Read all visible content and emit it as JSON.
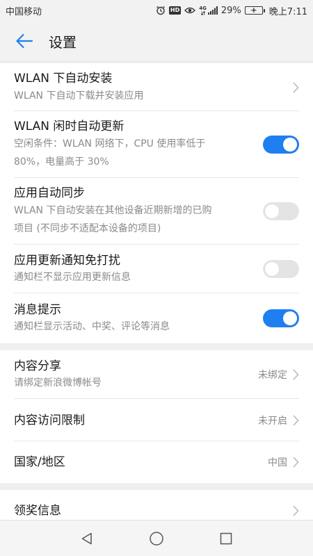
{
  "status_bar": {
    "carrier": "中国移动",
    "hd_label": "HD",
    "network_label": "4G",
    "battery_percent": "29%",
    "time": "晚上7:11",
    "icons": [
      "alarm-clock-icon",
      "hd-icon",
      "eye-icon",
      "network-4g-icon",
      "signal-icon",
      "battery-charging-icon"
    ]
  },
  "header": {
    "title": "设置",
    "back_icon": "arrow-left-icon",
    "accent_color": "#1f7ff0"
  },
  "settings": {
    "wlan_auto_install": {
      "title": "WLAN 下自动安装",
      "desc": "WLAN 下自动下载并安装应用"
    },
    "wlan_idle_update": {
      "title": "WLAN 闲时自动更新",
      "desc_line1": "空闲条件：WLAN 网络下，CPU 使用率低于",
      "desc_line2": "80%，电量高于 30%",
      "enabled": true
    },
    "app_auto_sync": {
      "title": "应用自动同步",
      "desc_line1": "WLAN 下自动安装在其他设备近期新增的已购",
      "desc_line2": "项目 (不同步不适配本设备的项目)",
      "enabled": false
    },
    "update_notify_dnd": {
      "title": "应用更新通知免打扰",
      "desc": "通知栏不显示应用更新信息",
      "enabled": false
    },
    "message_tips": {
      "title": "消息提示",
      "desc": "通知栏显示活动、中奖、评论等消息",
      "enabled": true
    },
    "content_share": {
      "title": "内容分享",
      "desc": "请绑定新浪微博帐号",
      "value": "未绑定"
    },
    "content_access_limit": {
      "title": "内容访问限制",
      "value": "未开启"
    },
    "country_region": {
      "title": "国家/地区",
      "value": "中国"
    },
    "prize_info": {
      "title": "领奖信息"
    }
  },
  "nav_bar": {
    "icons": [
      "back-triangle-icon",
      "home-circle-icon",
      "recent-square-icon"
    ]
  }
}
